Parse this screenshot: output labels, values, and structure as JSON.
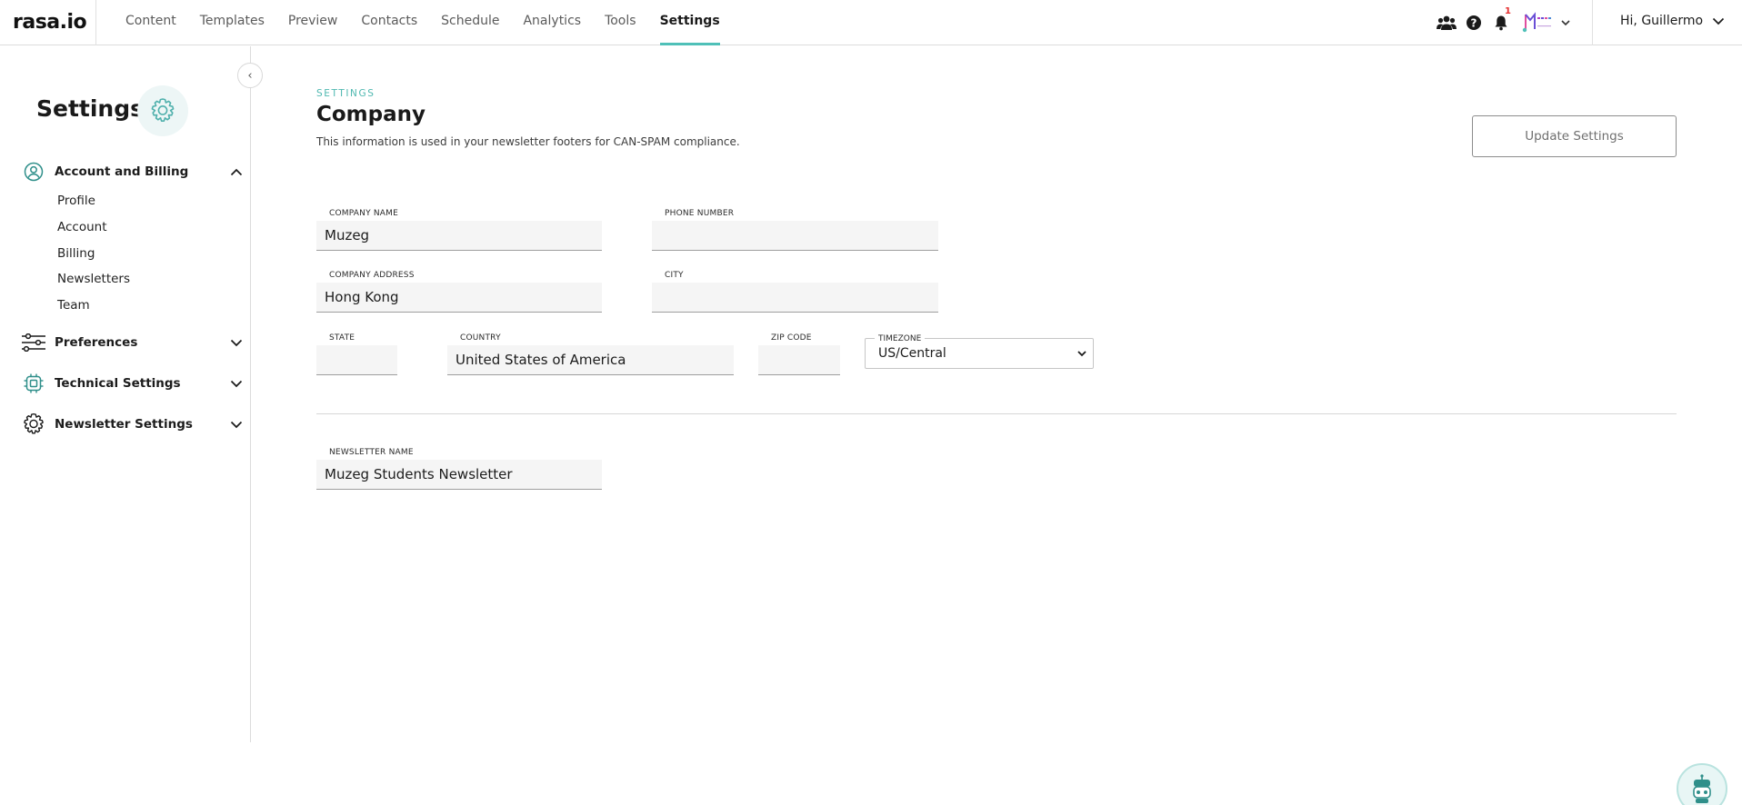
{
  "app": {
    "logo": "rasa.io"
  },
  "nav": {
    "items": [
      {
        "label": "Content"
      },
      {
        "label": "Templates"
      },
      {
        "label": "Preview"
      },
      {
        "label": "Contacts"
      },
      {
        "label": "Schedule"
      },
      {
        "label": "Analytics"
      },
      {
        "label": "Tools"
      },
      {
        "label": "Settings"
      }
    ],
    "active": "Settings"
  },
  "topbar": {
    "notification_count": "1",
    "brand_icon": "muzeg-logo",
    "greeting": "Hi, Guillermo"
  },
  "sidebar": {
    "title": "Settings",
    "collapse_glyph": "‹",
    "sections": [
      {
        "label": "Account and Billing",
        "icon": "account-circle-icon",
        "expanded": true,
        "items": [
          {
            "label": "Profile"
          },
          {
            "label": "Account"
          },
          {
            "label": "Billing"
          },
          {
            "label": "Newsletters"
          },
          {
            "label": "Team"
          }
        ]
      },
      {
        "label": "Preferences",
        "icon": "sliders-icon",
        "expanded": false
      },
      {
        "label": "Technical Settings",
        "icon": "chip-icon",
        "expanded": false
      },
      {
        "label": "Newsletter Settings",
        "icon": "gear-icon",
        "expanded": false
      }
    ]
  },
  "main": {
    "eyebrow": "SETTINGS",
    "title": "Company",
    "subtitle": "This information is used in your newsletter footers for CAN-SPAM compliance.",
    "update_button": "Update Settings",
    "fields": {
      "company_name": {
        "label": "COMPANY NAME",
        "value": "Muzeg"
      },
      "phone_number": {
        "label": "PHONE NUMBER",
        "value": ""
      },
      "company_address": {
        "label": "COMPANY ADDRESS",
        "value": "Hong Kong"
      },
      "city": {
        "label": "CITY",
        "value": ""
      },
      "state": {
        "label": "STATE",
        "value": ""
      },
      "country": {
        "label": "COUNTRY",
        "value": "United States of America"
      },
      "zip_code": {
        "label": "ZIP CODE",
        "value": ""
      },
      "timezone": {
        "label": "TIMEZONE",
        "value": "US/Central"
      },
      "newsletter_name": {
        "label": "NEWSLETTER NAME",
        "value": "Muzeg Students Newsletter"
      }
    }
  },
  "colors": {
    "accent": "#4fc0b8",
    "badge": "#e52d2d",
    "text": "#1c1c1c"
  }
}
